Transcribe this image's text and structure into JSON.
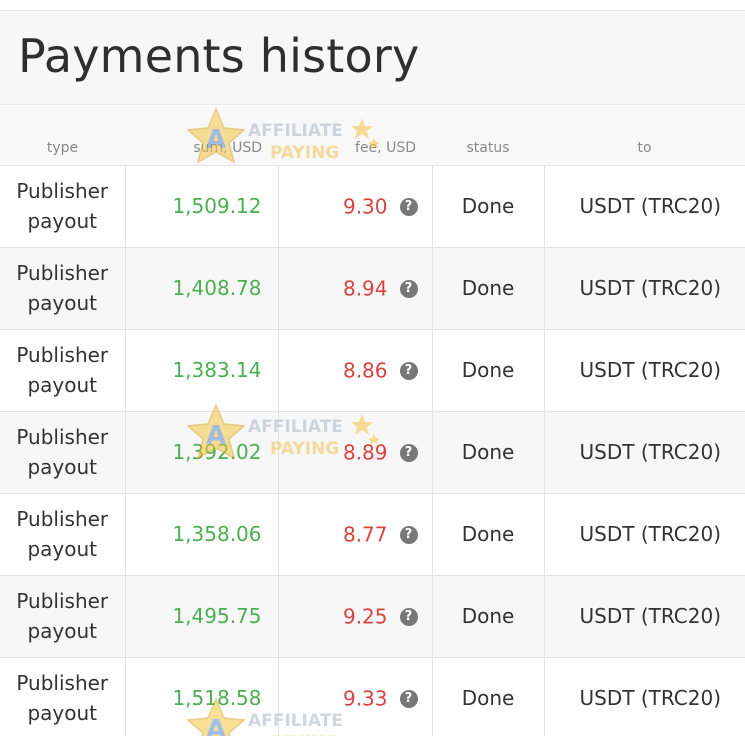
{
  "page": {
    "title": "Payments history"
  },
  "table": {
    "headers": {
      "type": "type",
      "sum": "sum, USD",
      "fee": "fee, USD",
      "status": "status",
      "to": "to"
    },
    "rows": [
      {
        "type_line1": "Publisher",
        "type_line2": "payout",
        "sum": "1,509.12",
        "fee": "9.30",
        "status": "Done",
        "to": "USDT (TRC20)"
      },
      {
        "type_line1": "Publisher",
        "type_line2": "payout",
        "sum": "1,408.78",
        "fee": "8.94",
        "status": "Done",
        "to": "USDT (TRC20)"
      },
      {
        "type_line1": "Publisher",
        "type_line2": "payout",
        "sum": "1,383.14",
        "fee": "8.86",
        "status": "Done",
        "to": "USDT (TRC20)"
      },
      {
        "type_line1": "Publisher",
        "type_line2": "payout",
        "sum": "1,392.02",
        "fee": "8.89",
        "status": "Done",
        "to": "USDT (TRC20)"
      },
      {
        "type_line1": "Publisher",
        "type_line2": "payout",
        "sum": "1,358.06",
        "fee": "8.77",
        "status": "Done",
        "to": "USDT (TRC20)"
      },
      {
        "type_line1": "Publisher",
        "type_line2": "payout",
        "sum": "1,495.75",
        "fee": "9.25",
        "status": "Done",
        "to": "USDT (TRC20)"
      },
      {
        "type_line1": "Publisher",
        "type_line2": "payout",
        "sum": "1,518.58",
        "fee": "9.33",
        "status": "Done",
        "to": "USDT (TRC20)"
      }
    ],
    "help_glyph": "?"
  },
  "watermark": {
    "line1": "AFFILIATE",
    "line2": "PAYING",
    "letter": "A"
  },
  "colors": {
    "sum": "#4caf50",
    "fee": "#d9433f",
    "help_icon": "#777777"
  }
}
